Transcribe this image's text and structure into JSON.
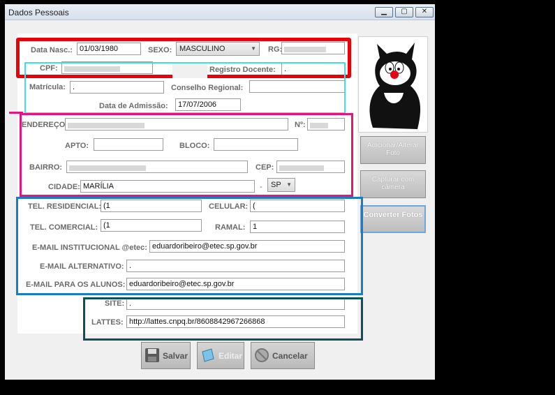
{
  "window": {
    "title": "Dados Pessoais",
    "minimize_icon": "minimize-icon",
    "maximize_icon": "maximize-icon",
    "close_icon": "close-icon"
  },
  "form": {
    "data_nasc_label": "Data Nasc.:",
    "data_nasc_value": "01/03/1980",
    "sexo_label": "SEXO:",
    "sexo_value": "MASCULINO",
    "rg_label": "RG:",
    "cpf_label": "CPF:",
    "registro_docente_label": "Registro Docente:",
    "registro_docente_value": ".",
    "matricula_label": "Matrícula:",
    "matricula_value": ".",
    "conselho_label": "Conselho Regional:",
    "admissao_label": "Data de Admissão:",
    "admissao_value": "17/07/2006",
    "endereco_label": "ENDEREÇO:",
    "numero_label": "Nº:",
    "apto_label": "APTO:",
    "bloco_label": "BLOCO:",
    "bairro_label": "BAIRRO:",
    "cep_label": "CEP:",
    "cidade_label": "CIDADE:",
    "cidade_value": "MARÍLIA",
    "dash": "-",
    "uf_value": "SP",
    "tel_res_label": "TEL. RESIDENCIAL:",
    "tel_res_value": "(1",
    "celular_label": "CELULAR:",
    "celular_value": "(",
    "tel_com_label": "TEL. COMERCIAL:",
    "tel_com_value": "(1",
    "ramal_label": "RAMAL:",
    "ramal_value": "1",
    "email_inst_label": "E-MAIL INSTITUCIONAL @etec:",
    "email_inst_value": "eduardoribeiro@etec.sp.gov.br",
    "email_alt_label": "E-MAIL ALTERNATIVO:",
    "email_alt_value": ".",
    "email_alunos_label": "E-MAIL PARA OS ALUNOS:",
    "email_alunos_value": "eduardoribeiro@etec.sp.gov.br",
    "site_label": "SITE:",
    "site_value": ".",
    "lattes_label": "LATTES:",
    "lattes_value": "http://lattes.cnpq.br/8608842967266868"
  },
  "side": {
    "photo_icon": "cartoon-cat-photo",
    "add_photo": "Adicionar/Alterar Foto",
    "capture": "Capturar com câmera",
    "convert": "Converter Fotos"
  },
  "buttons": {
    "save": "Salvar",
    "edit": "Editar",
    "cancel": "Cancelar"
  },
  "colors": {
    "red": "#e8000b",
    "cyan": "#3ee0e8",
    "pink": "#e6157b",
    "blue": "#1a7dc4",
    "teal": "#0f4f5a"
  }
}
